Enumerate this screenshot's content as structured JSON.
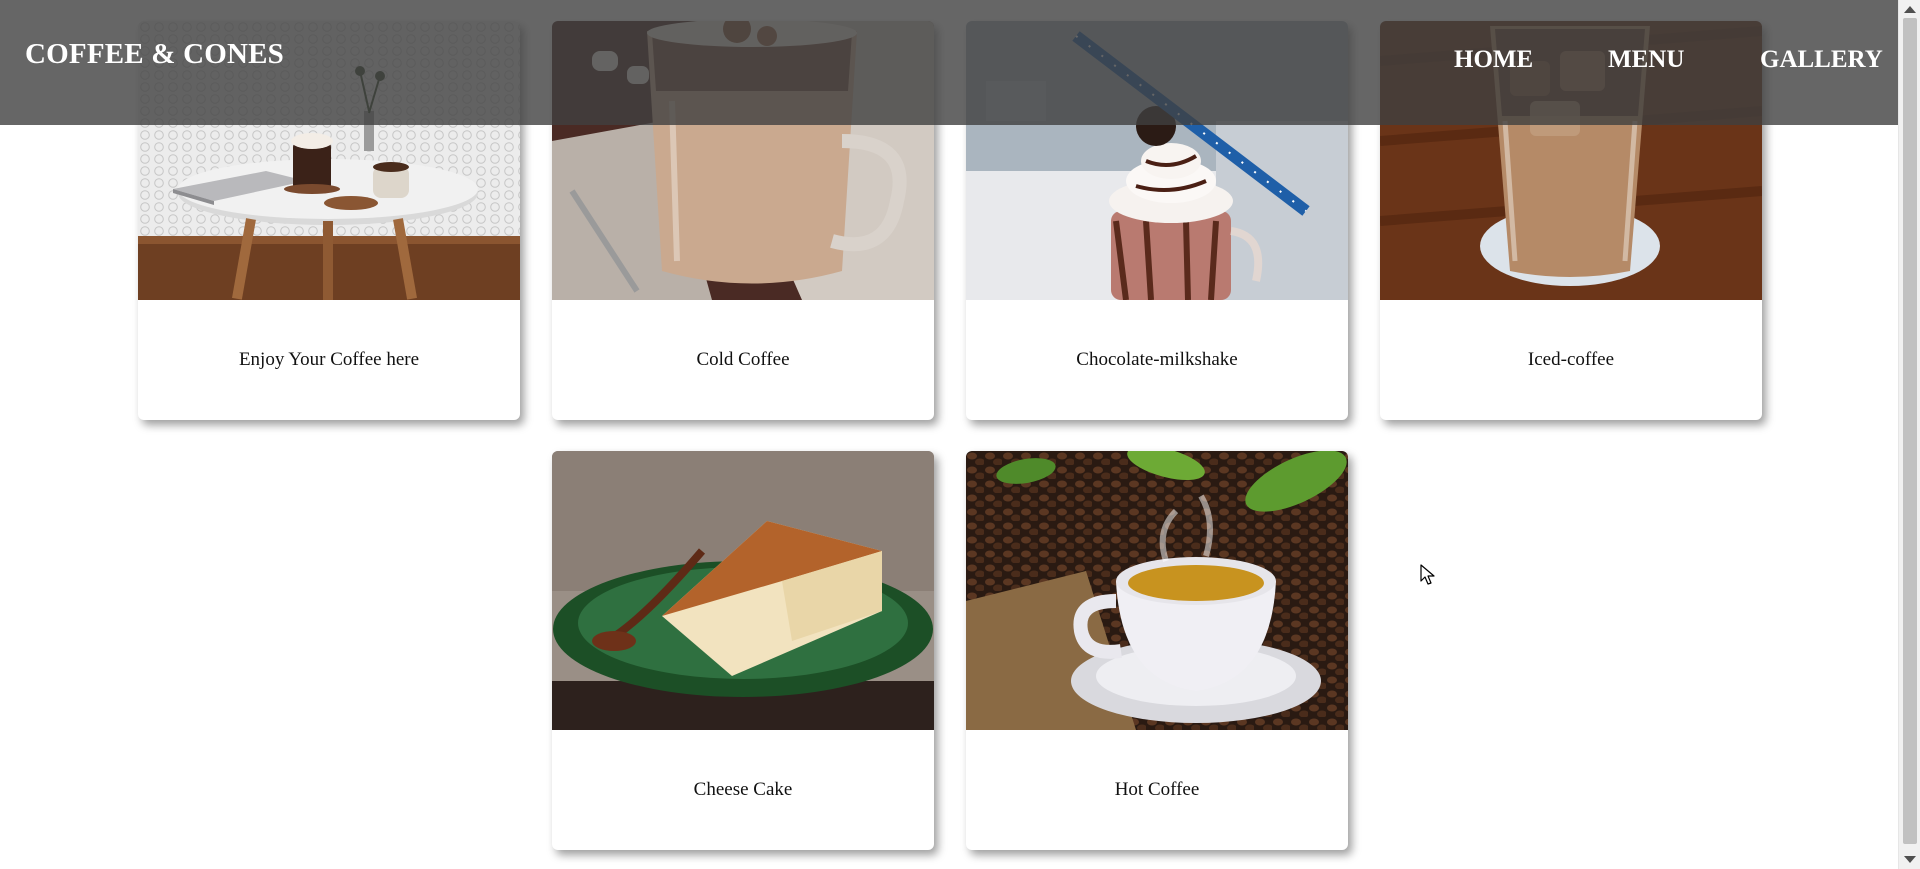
{
  "navbar": {
    "brand": "COFFEE & CONES",
    "links": [
      "HOME",
      "MENU",
      "GALLERY"
    ]
  },
  "gallery": {
    "cards": [
      {
        "caption": "Enjoy Your Coffee here",
        "image": "cafe-table-laptop-photo"
      },
      {
        "caption": "Cold Coffee",
        "image": "glass-mug-coffee-photo"
      },
      {
        "caption": "Chocolate-milkshake",
        "image": "milkshake-straw-photo"
      },
      {
        "caption": "Iced-coffee",
        "image": "iced-coffee-glass-photo"
      },
      {
        "caption": "Cheese Cake",
        "image": "cheesecake-slice-photo"
      },
      {
        "caption": "Hot Coffee",
        "image": "coffee-cup-beans-photo"
      }
    ]
  },
  "colors": {
    "navbar_bg": "#404040",
    "nav_text": "#ffffff",
    "page_bg": "#ffffff"
  }
}
